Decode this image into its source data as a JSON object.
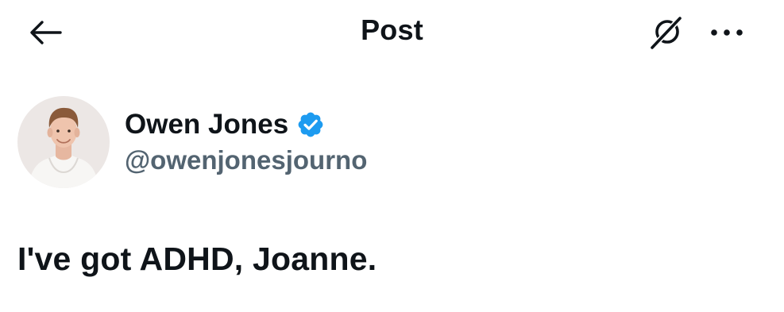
{
  "header": {
    "title": "Post",
    "back_icon": "arrow-left-icon",
    "grok_icon": "grok-icon",
    "more_icon": "more-horizontal-icon"
  },
  "post": {
    "author": {
      "display_name": "Owen Jones",
      "handle": "@owenjonesjourno",
      "verified": true,
      "verified_color": "#1d9bf0"
    },
    "text": "I've got ADHD, Joanne."
  },
  "colors": {
    "text_primary": "#0f1419",
    "text_secondary": "#536471",
    "background": "#ffffff"
  }
}
